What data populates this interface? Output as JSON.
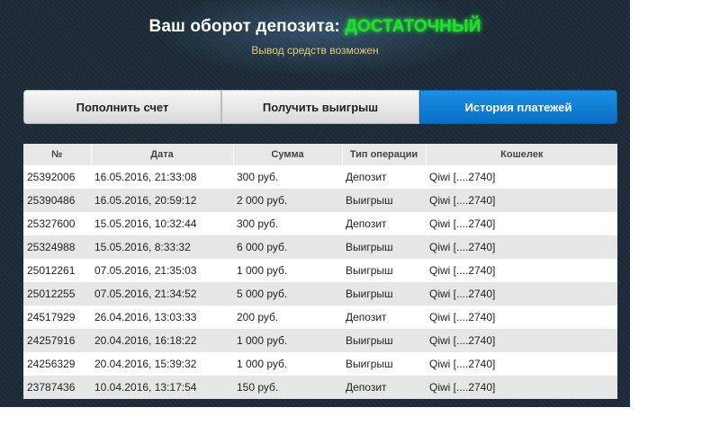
{
  "header": {
    "title": "Ваш оборот депозита:",
    "status": "ДОСТАТОЧНЫЙ",
    "subtitle": "Вывод средств возможен"
  },
  "tabs": [
    {
      "label": "Пополнить счет",
      "active": false
    },
    {
      "label": "Получить выигрыш",
      "active": false
    },
    {
      "label": "История платежей",
      "active": true
    }
  ],
  "table": {
    "headers": [
      "№",
      "Дата",
      "Сумма",
      "Тип операции",
      "Кошелек"
    ],
    "rows": [
      [
        "25392006",
        "16.05.2016, 21:33:08",
        "300 руб.",
        "Депозит",
        "Qiwi [....2740]"
      ],
      [
        "25390486",
        "16.05.2016, 20:59:12",
        "2 000 руб.",
        "Выигрыш",
        "Qiwi [....2740]"
      ],
      [
        "25327600",
        "15.05.2016, 10:32:44",
        "300 руб.",
        "Депозит",
        "Qiwi [....2740]"
      ],
      [
        "25324988",
        "15.05.2016, 8:33:32",
        "6 000 руб.",
        "Выигрыш",
        "Qiwi [....2740]"
      ],
      [
        "25012261",
        "07.05.2016, 21:35:03",
        "1 000 руб.",
        "Выигрыш",
        "Qiwi [....2740]"
      ],
      [
        "25012255",
        "07.05.2016, 21:34:52",
        "5 000 руб.",
        "Выигрыш",
        "Qiwi [....2740]"
      ],
      [
        "24517929",
        "26.04.2016, 13:03:33",
        "200 руб.",
        "Депозит",
        "Qiwi [....2740]"
      ],
      [
        "24257916",
        "20.04.2016, 16:18:22",
        "1 000 руб.",
        "Выигрыш",
        "Qiwi [....2740]"
      ],
      [
        "24256329",
        "20.04.2016, 15:39:32",
        "1 000 руб.",
        "Выигрыш",
        "Qiwi [....2740]"
      ],
      [
        "23787436",
        "10.04.2016, 13:17:54",
        "150 руб.",
        "Депозит",
        "Qiwi [....2740]"
      ]
    ]
  },
  "colors": {
    "status_green": "#1fe02a",
    "subtitle_gold": "#e6cd6e",
    "active_tab_blue": "#0b6fc4"
  }
}
